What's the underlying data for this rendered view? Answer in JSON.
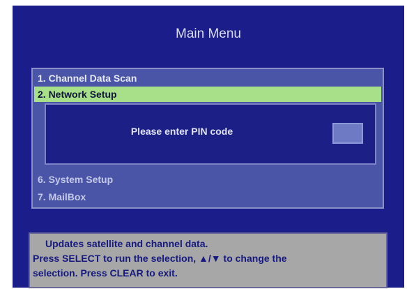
{
  "menu": {
    "title": "Main Menu",
    "items": [
      {
        "label": "1. Channel Data Scan"
      },
      {
        "label": "2. Network Setup"
      },
      {
        "label": "6. System Setup"
      },
      {
        "label": "7. MailBox"
      }
    ]
  },
  "pin_dialog": {
    "prompt": "Please enter PIN code",
    "value": ""
  },
  "help": {
    "line1": "Updates satellite and channel data.",
    "line2": "Press SELECT to run the selection, ▲/▼ to change the",
    "line3": "selection.  Press CLEAR to exit."
  },
  "colors": {
    "background": "#1b1d8a",
    "menu_panel": "#4a55a8",
    "selected_item": "#a8e089",
    "help_panel": "#a7a7a7"
  }
}
